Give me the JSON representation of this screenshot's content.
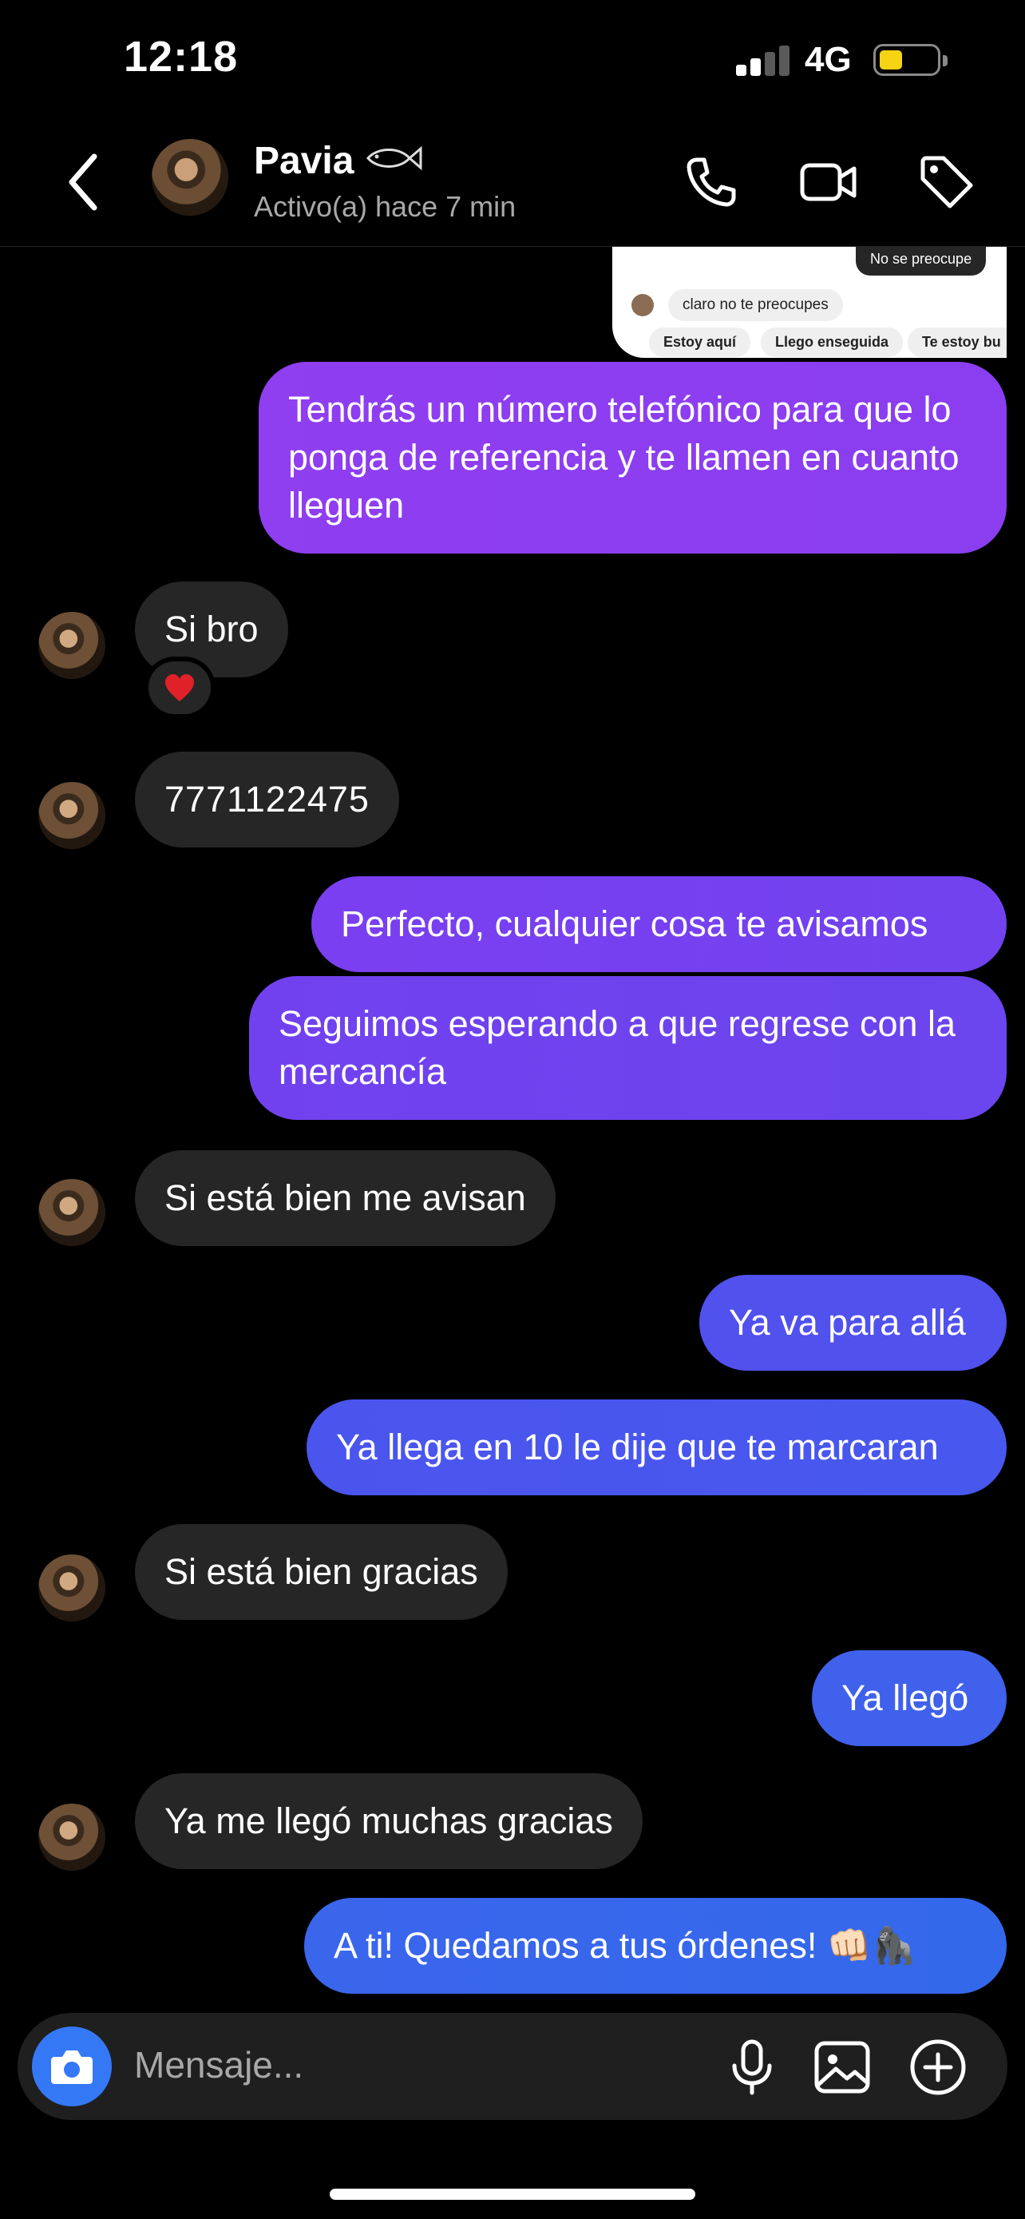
{
  "status_bar": {
    "time": "12:18",
    "network": "4G",
    "battery_color": "#f6d313"
  },
  "header": {
    "name": "Pavia",
    "status": "Activo(a) hace 7 min",
    "icons": [
      "back-chevron-icon",
      "fish-emoji-icon",
      "phone-icon",
      "video-camera-icon",
      "tag-icon"
    ]
  },
  "shared_screenshot": {
    "dark_text": "No se preocupe",
    "incoming_text": "claro no te preocupes",
    "quick_replies": [
      "Estoy aquí",
      "Llego enseguida",
      "Te estoy bu"
    ]
  },
  "messages": [
    {
      "dir": "out",
      "text": "Tendrás un número telefónico para que lo ponga de referencia y te llamen en cuanto lleguen"
    },
    {
      "dir": "in",
      "text": "Si bro",
      "reaction": "heart"
    },
    {
      "dir": "in",
      "text": "7771122475"
    },
    {
      "dir": "out",
      "text": "Perfecto, cualquier cosa te avisamos"
    },
    {
      "dir": "out",
      "text": "Seguimos esperando a que regrese con la mercancía"
    },
    {
      "dir": "in",
      "text": "Si está bien me avisan"
    },
    {
      "dir": "out",
      "text": "Ya va para allá"
    },
    {
      "dir": "out",
      "text": "Ya llega en 10 le dije que te marcaran"
    },
    {
      "dir": "in",
      "text": "Si está bien gracias"
    },
    {
      "dir": "out",
      "text": "Ya llegó"
    },
    {
      "dir": "in",
      "text": "Ya me llegó muchas gracias"
    },
    {
      "dir": "out",
      "text": "A ti! Quedamos a tus órdenes! 👊🏻🦍"
    }
  ],
  "composer": {
    "placeholder": "Mensaje...",
    "icons": [
      "camera-icon",
      "microphone-icon",
      "image-icon",
      "plus-circle-icon"
    ]
  },
  "colors": {
    "incoming_bubble": "#262626",
    "outgoing_gradient": [
      "#8f3ef0",
      "#3d64ec"
    ],
    "accent_blue": "#3478f6"
  }
}
